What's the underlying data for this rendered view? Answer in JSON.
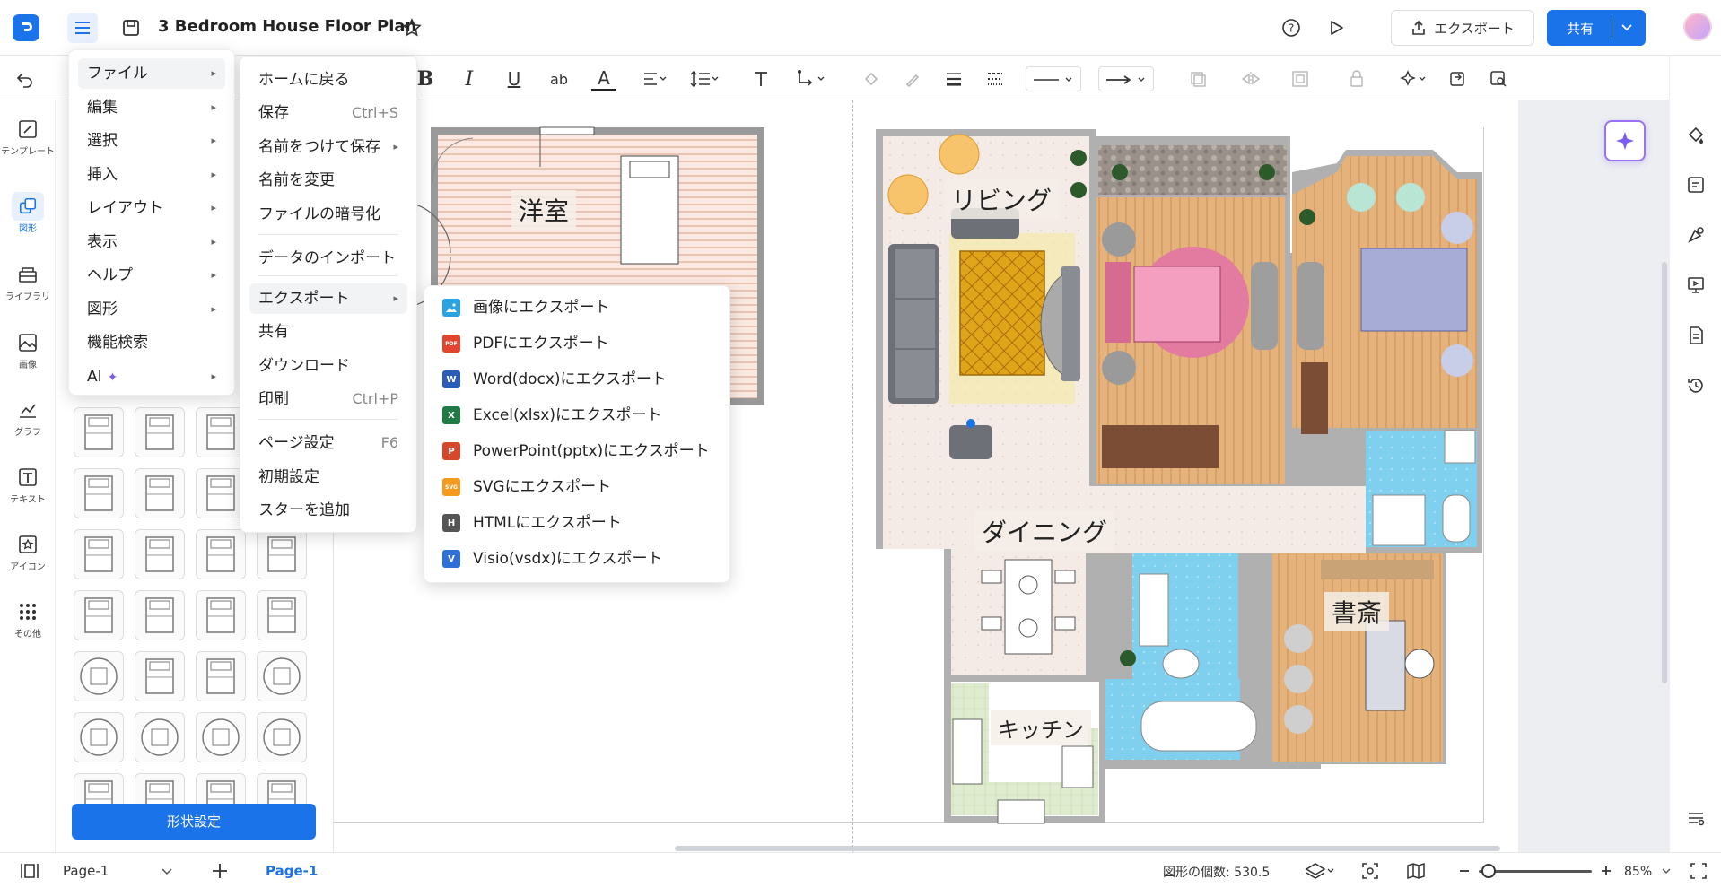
{
  "app": {
    "title": "3 Bedroom House Floor Plan",
    "logo_icon": "app-logo-icon"
  },
  "topbar": {
    "export_label": "エクスポート",
    "share_label": "共有",
    "accent": "#1a73e8"
  },
  "left_rail": {
    "items": [
      {
        "label": "テンプレート",
        "icon": "template-icon"
      },
      {
        "label": "図形",
        "icon": "shapes-icon"
      },
      {
        "label": "ライブラリ",
        "icon": "library-icon"
      },
      {
        "label": "画像",
        "icon": "image-icon"
      },
      {
        "label": "グラフ",
        "icon": "chart-icon"
      },
      {
        "label": "テキスト",
        "icon": "text-icon"
      },
      {
        "label": "アイコン",
        "icon": "icon-icon"
      },
      {
        "label": "その他",
        "icon": "more-icon"
      }
    ]
  },
  "library": {
    "shape_settings_button": "形状設定"
  },
  "main_menu": {
    "items": [
      {
        "label": "ファイル",
        "has_submenu": true
      },
      {
        "label": "編集",
        "has_submenu": true
      },
      {
        "label": "選択",
        "has_submenu": true
      },
      {
        "label": "挿入",
        "has_submenu": true
      },
      {
        "label": "レイアウト",
        "has_submenu": true
      },
      {
        "label": "表示",
        "has_submenu": true
      },
      {
        "label": "ヘルプ",
        "has_submenu": true
      },
      {
        "label": "図形",
        "has_submenu": true
      },
      {
        "label": "機能検索",
        "has_submenu": false
      },
      {
        "label": "AI",
        "has_submenu": true
      }
    ]
  },
  "file_menu": {
    "items": [
      {
        "label": "ホームに戻る",
        "shortcut": ""
      },
      {
        "label": "保存",
        "shortcut": "Ctrl+S"
      },
      {
        "label": "名前をつけて保存",
        "shortcut": ""
      },
      {
        "label": "名前を変更",
        "shortcut": ""
      },
      {
        "label": "ファイルの暗号化",
        "shortcut": ""
      },
      {
        "label": "データのインポート",
        "shortcut": ""
      },
      {
        "label": "エクスポート",
        "shortcut": ""
      },
      {
        "label": "共有",
        "shortcut": ""
      },
      {
        "label": "ダウンロード",
        "shortcut": ""
      },
      {
        "label": "印刷",
        "shortcut": "Ctrl+P"
      },
      {
        "label": "ページ設定",
        "shortcut": "F6"
      },
      {
        "label": "初期設定",
        "shortcut": ""
      },
      {
        "label": "スターを追加",
        "shortcut": ""
      }
    ]
  },
  "export_menu": {
    "items": [
      {
        "label": "画像にエクスポート",
        "badge": "",
        "color": "#2aa3e0"
      },
      {
        "label": "PDFにエクスポート",
        "badge": "PDF",
        "color": "#e2452f"
      },
      {
        "label": "Word(docx)にエクスポート",
        "badge": "W",
        "color": "#2b5cb8"
      },
      {
        "label": "Excel(xlsx)にエクスポート",
        "badge": "X",
        "color": "#1f7a44"
      },
      {
        "label": "PowerPoint(pptx)にエクスポート",
        "badge": "P",
        "color": "#d5482b"
      },
      {
        "label": "SVGにエクスポート",
        "badge": "SVG",
        "color": "#f39a1f"
      },
      {
        "label": "HTMLにエクスポート",
        "badge": "H",
        "color": "#555555"
      },
      {
        "label": "Visio(vsdx)にエクスポート",
        "badge": "V",
        "color": "#2f6fd8"
      }
    ]
  },
  "floor_plan": {
    "rooms": [
      "洋室",
      "リビング",
      "ダイニング",
      "書斎",
      "キッチン"
    ]
  },
  "status": {
    "page_select": "Page-1",
    "page_tab": "Page-1",
    "shape_count": "図形の個数: 530.5",
    "zoom": "85%"
  }
}
